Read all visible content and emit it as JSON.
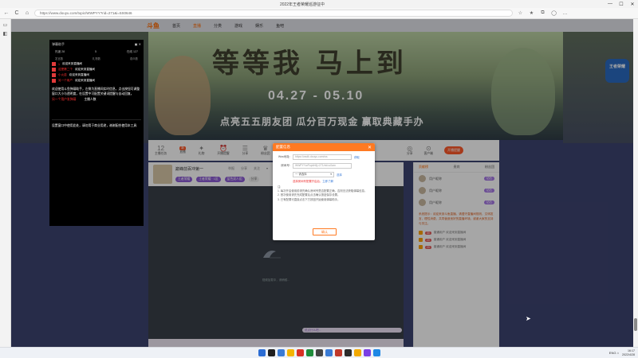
{
  "window": {
    "title": "2022年王者荣耀巡游征中",
    "min": "—",
    "max": "☐",
    "close": "✕"
  },
  "browser": {
    "url": "https://www.douyu.com/topic/WWPYY?rid=271&i=5S0646",
    "back": "←",
    "reload": "C",
    "home": "⌂",
    "lock": "🔒"
  },
  "site": {
    "logo": "斗鱼",
    "nav": [
      "首页",
      "直播",
      "分类",
      "游戏",
      "娱乐",
      "鱼吧"
    ],
    "active_nav": 1
  },
  "banner": {
    "title": "等等我 马上到",
    "dates": "04.27 - 05.10",
    "slogan": "点亮五五朋友团 瓜分百万现金 赢取典藏手办",
    "side_badge": "王者荣耀"
  },
  "toolbar": {
    "items": [
      {
        "icon": "12",
        "label": "主播任务"
      },
      {
        "icon": "▣",
        "label": "直播"
      },
      {
        "icon": "✦",
        "label": "礼物"
      },
      {
        "icon": "⏰",
        "label": "开播提醒"
      },
      {
        "icon": "☰",
        "label": "分享"
      },
      {
        "icon": "♛",
        "label": "粉丝团"
      },
      {
        "icon": "⚑",
        "label": "活动"
      }
    ],
    "tag": "新",
    "right_items": [
      {
        "icon": "◎",
        "label": "分享"
      },
      {
        "icon": "⊙",
        "label": "客户端"
      }
    ],
    "open_btn": "开播提醒"
  },
  "stream": {
    "title": "巅峰前百冲第一",
    "actions": [
      "举报",
      "分享",
      "关注",
      "▾"
    ],
    "tags": [
      "王者荣耀",
      "王者荣耀 · 1区",
      "蓝色双人组",
      "分享"
    ],
    "hint": "视频加载中，请稍候..."
  },
  "chat_placeholder": "说点什么吧...",
  "sidebar": {
    "tabs": [
      "贡献榜",
      "贵宾",
      "粉丝团"
    ],
    "rows": [
      {
        "name": "用户昵称",
        "badge": "钻石"
      },
      {
        "name": "用户昵称",
        "badge": "钻石"
      },
      {
        "name": "用户昵称",
        "badge": "钻石"
      }
    ],
    "notice": "系统提示：欢迎来到斗鱼直播，请遵守直播间规则，文明发言，理性消费，共同营造良好的直播环境，谢谢大家的支持与关注。",
    "lines": [
      {
        "pill": "30",
        "text": "普通用户 欢迎来到直播间"
      },
      {
        "pill": "20",
        "text": "普通用户 欢迎来到直播间"
      },
      {
        "pill": "20",
        "text": "普通用户 欢迎来到直播间"
      }
    ]
  },
  "overlay": {
    "title": "弹幕助手",
    "head_right": "▣ ✕",
    "stats": [
      "热度 28",
      "5",
      "在线 127"
    ],
    "cols": [
      "发言数",
      "礼物数",
      "观众数"
    ],
    "items": [
      {
        "who": "1",
        "what": "欢迎来到直播间"
      },
      {
        "who": "这是第二个",
        "what": "欢迎来到直播间"
      },
      {
        "who": "小火苗",
        "what": "欢迎来到直播间"
      },
      {
        "who": "另一个用户",
        "what": "欢迎来到直播间"
      }
    ],
    "para": "欢迎使用斗鱼弹幕助手，左侧为直播间实时信息，点击按钮可调整窗口大小与透明度，在设置中可配置关键词提醒与自动回复。",
    "foot_red": "另一个用户发弹幕",
    "foot_white": "主播人数",
    "bottom": "设置窗口中使用此处，请勿用于商业用途，谢谢配合使用本工具"
  },
  "modal": {
    "title": "配置信息",
    "close": "✕",
    "rows": [
      {
        "label": "Wss地址:",
        "value": "https://wsdk.douyu.com/ws",
        "link": "获取"
      },
      {
        "label": "房间号:",
        "value": "WWPYYwPopt/n5j=271/rid=u0am"
      }
    ],
    "select_label": "",
    "select_value": "一 请选择",
    "select_link": "选择",
    "warn": "选择房间号配置开启后，",
    "warn_link": "立即了解",
    "notes": [
      "注:",
      "1.  每次开启使用前请先确认房间号是否配置正确，否则无法获取弹幕信息。",
      "2.  首次使用请先完成配置后点击确认按钮保存设置。",
      "3.  已有配置可直接点击下方按钮开始使用弹幕助手。"
    ],
    "button": "确认"
  },
  "taskbar": {
    "apps": [
      "#2b6cd3",
      "#1f1f1f",
      "#3a7bd5",
      "#f4b400",
      "#d93025",
      "#1f8c3b",
      "#444444",
      "#3a7bd5",
      "#c0392b",
      "#2b2b2b",
      "#f2a900",
      "#7b3fe4",
      "#1e88e5"
    ],
    "tray": "ENG ⌂",
    "time": "16:17",
    "date": "2022/4/28"
  }
}
